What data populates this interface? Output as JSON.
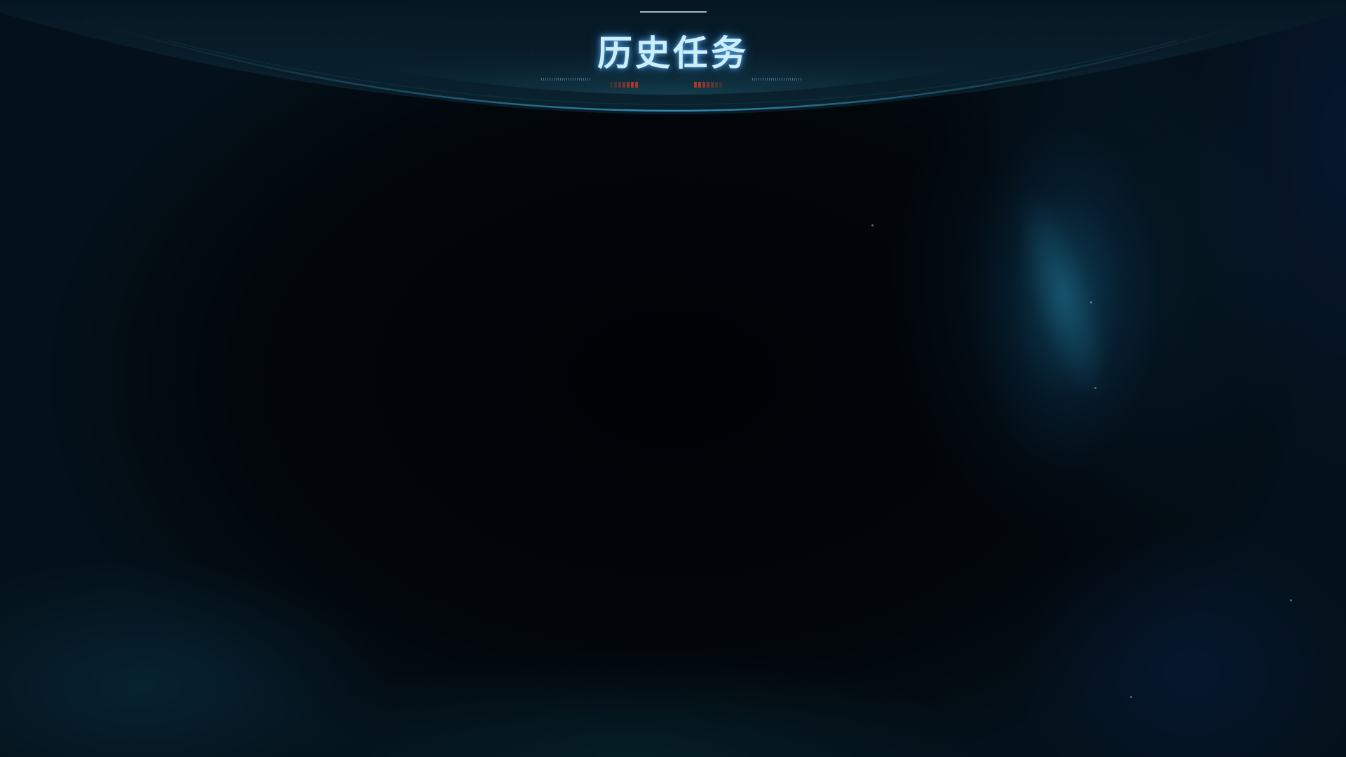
{
  "header": {
    "title": "历史任务"
  },
  "colors": {
    "title_glow": "#5ab4ff",
    "title_text": "#cdeeff",
    "frame_accent": "#1e6a8c",
    "tick_red": "#a8382a",
    "background": "#02070c"
  }
}
